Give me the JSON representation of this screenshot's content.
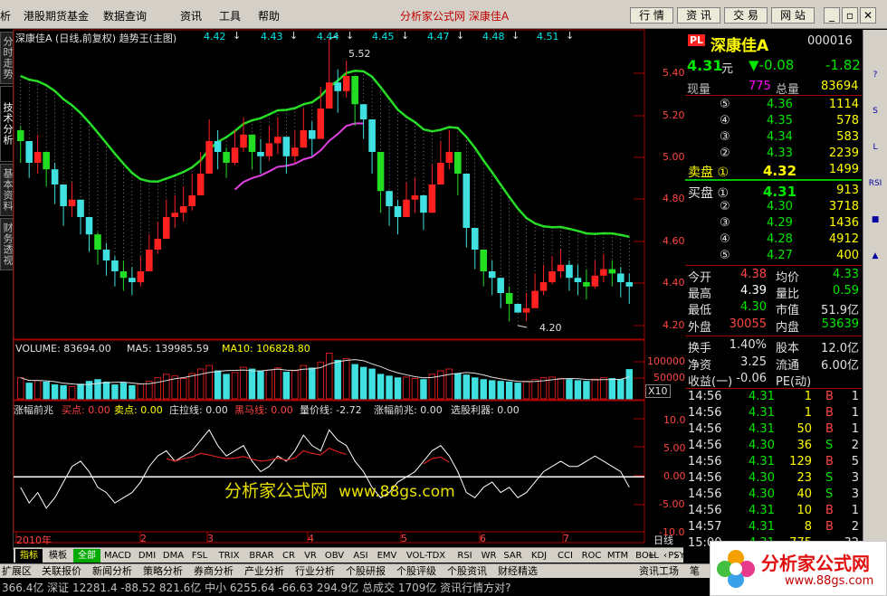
{
  "menu": {
    "items": [
      "析",
      "港股期货基金",
      "数据查询",
      "资讯",
      "工具",
      "帮助"
    ],
    "title": "分析家公式网  深康佳A",
    "toolbar_buttons": [
      "行 情",
      "资 讯",
      "交 易",
      "网 站"
    ]
  },
  "left_tabs": [
    "分时走势",
    "技术分析",
    "基本资料",
    "财务透视"
  ],
  "chart_header": {
    "title": "深康佳A (日线,前复权) 趋势王(主图)",
    "levels": [
      "4.42",
      "4.43",
      "4.44",
      "4.45",
      "4.47",
      "4.48",
      "4.51"
    ],
    "high_mark": "5.52",
    "low_mark": "4.20"
  },
  "price_axis": [
    "5.40",
    "5.20",
    "5.00",
    "4.80",
    "4.60",
    "4.40",
    "4.20"
  ],
  "volume_header": {
    "volume": "VOLUME: 83694.00",
    "ma5": "MA5: 139985.59",
    "ma10": "MA10: 106828.80"
  },
  "volume_axis": [
    "100000",
    "50000",
    "X10"
  ],
  "indicator_header": {
    "name": "涨幅前兆",
    "buy": "买点: 0.00",
    "sell": "卖点: 0.00",
    "zhuang": "庄拉线: 0.00",
    "heima": "黑马线: 0.00",
    "liangjia": "量价线: -2.72",
    "zhangfu": "涨幅前兆: 0.00",
    "xuangu": "选股利器: 0.00"
  },
  "indicator_axis": [
    "10.00",
    "5.00",
    "0.00",
    "-5.00",
    "-10.00"
  ],
  "time_axis": [
    "2010年",
    "2",
    "3",
    "4",
    "5",
    "6",
    "7"
  ],
  "period_label": "日线",
  "watermark": {
    "brand": "分析家公式网",
    "url": "www.88gs.com"
  },
  "stock": {
    "code_badge": "PL",
    "name": "深康佳A",
    "code": "000016",
    "price": "4.31",
    "price_unit": "元",
    "change": "▼-0.08",
    "change_pct": "-1.82",
    "current_vol_label": "现量",
    "current_vol": "775",
    "total_vol_label": "总量",
    "total_vol": "83694"
  },
  "asks": [
    {
      "label": "⑤",
      "price": "4.36",
      "vol": "1114"
    },
    {
      "label": "④",
      "price": "4.35",
      "vol": "578"
    },
    {
      "label": "③",
      "price": "4.34",
      "vol": "583"
    },
    {
      "label": "②",
      "price": "4.33",
      "vol": "2239"
    },
    {
      "label": "卖盘 ①",
      "price": "4.32",
      "vol": "1499"
    }
  ],
  "bids": [
    {
      "label": "买盘 ①",
      "price": "4.31",
      "vol": "913"
    },
    {
      "label": "②",
      "price": "4.30",
      "vol": "3718"
    },
    {
      "label": "③",
      "price": "4.29",
      "vol": "1436"
    },
    {
      "label": "④",
      "price": "4.28",
      "vol": "4912"
    },
    {
      "label": "⑤",
      "price": "4.27",
      "vol": "400"
    }
  ],
  "stats": [
    {
      "l1": "今开",
      "v1": "4.38",
      "l2": "均价",
      "v2": "4.33"
    },
    {
      "l1": "最高",
      "v1": "4.39",
      "l2": "量比",
      "v2": "0.59"
    },
    {
      "l1": "最低",
      "v1": "4.30",
      "l2": "市值",
      "v2": "51.9亿"
    },
    {
      "l1": "外盘",
      "v1": "30055",
      "l2": "内盘",
      "v2": "53639"
    }
  ],
  "stats2": [
    {
      "l1": "换手",
      "v1": "1.40%",
      "l2": "股本",
      "v2": "12.0亿"
    },
    {
      "l1": "净资",
      "v1": "3.25",
      "l2": "流通",
      "v2": "6.00亿"
    },
    {
      "l1": "收益(一)",
      "v1": "-0.06",
      "l2": "PE(动)",
      "v2": ""
    }
  ],
  "ticks": [
    {
      "time": "14:56",
      "price": "4.31",
      "vol": "1",
      "side": "B",
      "n": "1"
    },
    {
      "time": "14:56",
      "price": "4.31",
      "vol": "1",
      "side": "B",
      "n": "1"
    },
    {
      "time": "14:56",
      "price": "4.31",
      "vol": "50",
      "side": "B",
      "n": "1"
    },
    {
      "time": "14:56",
      "price": "4.30",
      "vol": "36",
      "side": "S",
      "n": "2"
    },
    {
      "time": "14:56",
      "price": "4.31",
      "vol": "129",
      "side": "B",
      "n": "5"
    },
    {
      "time": "14:56",
      "price": "4.30",
      "vol": "23",
      "side": "S",
      "n": "3"
    },
    {
      "time": "14:56",
      "price": "4.30",
      "vol": "40",
      "side": "S",
      "n": "3"
    },
    {
      "time": "14:56",
      "price": "4.31",
      "vol": "10",
      "side": "B",
      "n": "1"
    },
    {
      "time": "14:57",
      "price": "4.31",
      "vol": "8",
      "side": "B",
      "n": "2"
    },
    {
      "time": "15:00",
      "price": "4.31",
      "vol": "775",
      "side": "",
      "n": "32"
    }
  ],
  "bottom_tabs": [
    "指标",
    "模板",
    "全部",
    "MACD",
    "DMI",
    "DMA",
    "FSL",
    "TRIX",
    "BRAR",
    "CR",
    "VR",
    "OBV",
    "ASI",
    "EMV",
    "VOL-TDX",
    "RSI",
    "WR",
    "SAR",
    "KDJ",
    "CCI",
    "ROC",
    "MTM",
    "BOLL",
    "PSY"
  ],
  "taskbar": [
    "扩展区",
    "关联报价",
    "新闻分析",
    "策略分析",
    "券商分析",
    "产业分析",
    "行业分析",
    "个股研报",
    "个股评级",
    "个股资讯",
    "财经精选",
    "资讯工场",
    "笔"
  ],
  "status_line": "366.4亿  深证 12281.4  -88.52  821.6亿  中小 6255.64  -66.63  294.9亿  总成交 1709亿  资讯行情方对?",
  "logo": {
    "brand": "分析家公式网",
    "url": "www.88gs.com"
  },
  "sidebar_items": [
    "?",
    "S",
    "L",
    "RSI",
    "■",
    "▲"
  ],
  "chart_data": {
    "type": "candlestick",
    "title": "深康佳A (日线,前复权) 趋势王(主图)",
    "ylim": [
      4.15,
      5.5
    ],
    "x_labels": [
      "2010年",
      "2",
      "3",
      "4",
      "5",
      "6",
      "7"
    ],
    "close": [
      5.05,
      4.95,
      5.0,
      4.92,
      4.85,
      4.75,
      4.78,
      4.7,
      4.62,
      4.55,
      4.5,
      4.45,
      4.42,
      4.4,
      4.45,
      4.55,
      4.6,
      4.7,
      4.72,
      4.75,
      4.8,
      4.9,
      5.05,
      5.0,
      4.95,
      5.02,
      5.08,
      5.0,
      4.98,
      5.04,
      5.07,
      4.98,
      5.02,
      5.1,
      5.06,
      5.2,
      5.32,
      5.28,
      5.35,
      5.22,
      5.15,
      5.0,
      4.82,
      4.75,
      4.7,
      4.78,
      4.8,
      4.72,
      4.85,
      4.95,
      5.0,
      4.9,
      4.65,
      4.55,
      4.45,
      4.42,
      4.35,
      4.3,
      4.26,
      4.28,
      4.36,
      4.4,
      4.45,
      4.48,
      4.42,
      4.4,
      4.38,
      4.43,
      4.46,
      4.44,
      4.4,
      4.38
    ],
    "high": [
      5.12,
      5.05,
      5.08,
      5.0,
      4.95,
      4.84,
      4.86,
      4.78,
      4.7,
      4.63,
      4.58,
      4.52,
      4.5,
      4.47,
      4.52,
      4.62,
      4.68,
      4.78,
      4.8,
      4.84,
      4.9,
      5.0,
      5.15,
      5.1,
      5.02,
      5.1,
      5.16,
      5.08,
      5.06,
      5.12,
      5.16,
      5.06,
      5.1,
      5.2,
      5.14,
      5.3,
      5.52,
      5.38,
      5.42,
      5.3,
      5.22,
      5.08,
      4.9,
      4.82,
      4.78,
      4.86,
      4.88,
      4.8,
      4.94,
      5.05,
      5.1,
      4.98,
      4.74,
      4.62,
      4.54,
      4.5,
      4.42,
      4.38,
      4.2,
      4.35,
      4.44,
      4.48,
      4.52,
      4.55,
      4.5,
      4.48,
      4.46,
      4.5,
      4.53,
      4.5,
      4.47,
      4.44
    ],
    "low": [
      4.95,
      4.88,
      4.9,
      4.84,
      4.76,
      4.66,
      4.7,
      4.62,
      4.54,
      4.48,
      4.43,
      4.38,
      4.36,
      4.34,
      4.38,
      4.48,
      4.53,
      4.62,
      4.65,
      4.68,
      4.73,
      4.82,
      4.96,
      4.92,
      4.88,
      4.94,
      5.0,
      4.92,
      4.9,
      4.96,
      4.99,
      4.9,
      4.95,
      5.02,
      4.98,
      5.1,
      5.22,
      5.18,
      5.25,
      5.12,
      5.06,
      4.9,
      4.72,
      4.66,
      4.62,
      4.7,
      4.72,
      4.64,
      4.77,
      4.86,
      4.92,
      4.8,
      4.56,
      4.46,
      4.38,
      4.34,
      4.28,
      4.22,
      4.2,
      4.22,
      4.3,
      4.34,
      4.39,
      4.42,
      4.36,
      4.34,
      4.32,
      4.37,
      4.4,
      4.38,
      4.33,
      4.3
    ],
    "volume": [
      60000,
      45000,
      52000,
      48000,
      40000,
      38000,
      35000,
      42000,
      50000,
      55000,
      48000,
      40000,
      45000,
      38000,
      42000,
      50000,
      60000,
      70000,
      65000,
      58000,
      72000,
      85000,
      95000,
      80000,
      70000,
      75000,
      90000,
      85000,
      78000,
      82000,
      88000,
      76000,
      80000,
      95000,
      88000,
      105000,
      130000,
      110000,
      115000,
      98000,
      90000,
      85000,
      70000,
      65000,
      60000,
      62000,
      58000,
      55000,
      70000,
      80000,
      85000,
      72000,
      68000,
      60000,
      55000,
      52000,
      50000,
      48000,
      45000,
      50000,
      55000,
      60000,
      62000,
      58000,
      55000,
      52000,
      50000,
      56000,
      60000,
      58000,
      55000,
      83694
    ],
    "volume_axis": [
      100000,
      50000
    ],
    "indicator": [
      -2,
      -5,
      -3,
      -6,
      -4,
      -1,
      2,
      3,
      1,
      -2,
      -3,
      -5,
      -4,
      -3,
      -1,
      2,
      4,
      5,
      3,
      4,
      5,
      7,
      9,
      6,
      4,
      5,
      6,
      3,
      1,
      2,
      4,
      3,
      5,
      8,
      6,
      5,
      9,
      7,
      6,
      3,
      1,
      -2,
      -4,
      -3,
      -1,
      0,
      1,
      3,
      5,
      6,
      4,
      1,
      -3,
      -4,
      -2,
      -1,
      -3,
      -2,
      -4,
      -3,
      -1,
      1,
      2,
      3,
      2,
      2,
      3,
      4,
      3,
      2,
      1,
      -2
    ],
    "indicator2": [
      null,
      null,
      null,
      null,
      null,
      null,
      null,
      null,
      null,
      null,
      null,
      null,
      null,
      null,
      null,
      null,
      null,
      3.5,
      3,
      3.5,
      3.8,
      4.5,
      4.2,
      3.8,
      3.5,
      3.6,
      3.9,
      3.4,
      3,
      3.2,
      3.6,
      3.2,
      3.6,
      5,
      4.5,
      4.2,
      5.5,
      4.8,
      4.3,
      null,
      null,
      null,
      null,
      null,
      null,
      null,
      null,
      2.5,
      3.5,
      3.8,
      2.8,
      null,
      null,
      null,
      null,
      null,
      null,
      null,
      null,
      null,
      null,
      null,
      null,
      null,
      null,
      null,
      null,
      null,
      null,
      null,
      null,
      null
    ],
    "indicator_ylim": [
      -10,
      12
    ]
  }
}
